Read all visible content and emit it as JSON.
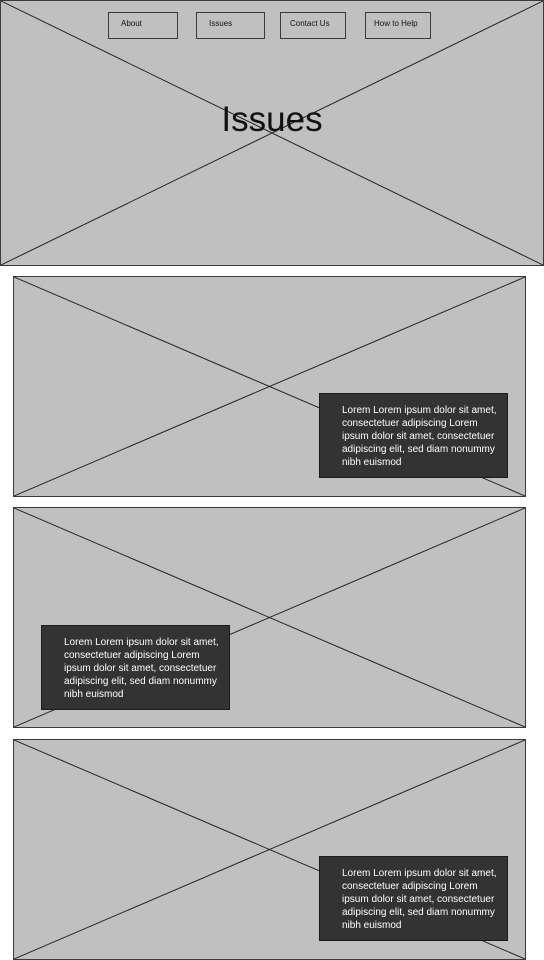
{
  "nav": {
    "items": [
      {
        "label": "About"
      },
      {
        "label": "Issues"
      },
      {
        "label": "Contact Us"
      },
      {
        "label": "How to Help"
      }
    ]
  },
  "hero": {
    "title": "Issues"
  },
  "sections": [
    {
      "text": "Lorem Lorem ipsum dolor sit amet, consectetuer adipiscing Lorem ipsum dolor sit amet, consectetuer adipiscing elit, sed diam nonummy nibh euismod"
    },
    {
      "text": "Lorem Lorem ipsum dolor sit amet, consectetuer adipiscing Lorem ipsum dolor sit amet, consectetuer adipiscing elit, sed diam nonummy nibh euismod"
    },
    {
      "text": "Lorem Lorem ipsum dolor sit amet, consectetuer adipiscing Lorem ipsum dolor sit amet, consectetuer adipiscing elit, sed diam nonummy nibh euismod"
    }
  ]
}
